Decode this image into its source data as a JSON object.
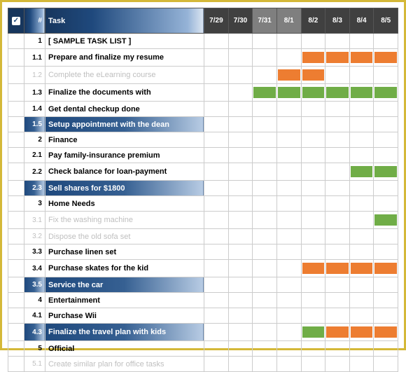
{
  "header": {
    "check": "✓",
    "num": "#",
    "task": "Task",
    "dates": [
      "7/29",
      "7/30",
      "7/31",
      "8/1",
      "8/2",
      "8/3",
      "8/4",
      "8/5"
    ],
    "highlight_cols": [
      2,
      3
    ]
  },
  "rows": [
    {
      "num": "1",
      "task": "[ SAMPLE TASK LIST ]",
      "style": "normal",
      "bars": []
    },
    {
      "num": "1.1",
      "task": "Prepare and finalize my resume",
      "style": "normal",
      "bars": [
        {
          "col": 4,
          "len": 4,
          "type": "orange"
        }
      ]
    },
    {
      "num": "1.2",
      "task": "Complete the eLearning course",
      "style": "faded",
      "bars": [
        {
          "col": 3,
          "len": 2,
          "type": "orange"
        }
      ]
    },
    {
      "num": "1.3",
      "task": "Finalize the documents with",
      "style": "normal",
      "bars": [
        {
          "col": 2,
          "len": 6,
          "type": "green"
        }
      ]
    },
    {
      "num": "1.4",
      "task": "Get dental checkup done",
      "style": "normal",
      "bars": []
    },
    {
      "num": "1.5",
      "task": "Setup appointment with the dean",
      "style": "highlight",
      "bars": []
    },
    {
      "num": "2",
      "task": "Finance",
      "style": "normal",
      "bars": []
    },
    {
      "num": "2.1",
      "task": "Pay family-insurance premium",
      "style": "normal",
      "bars": []
    },
    {
      "num": "2.2",
      "task": "Check balance for loan-payment",
      "style": "normal",
      "bars": [
        {
          "col": 6,
          "len": 2,
          "type": "green"
        }
      ]
    },
    {
      "num": "2.3",
      "task": "Sell shares for $1800",
      "style": "highlight",
      "bars": []
    },
    {
      "num": "3",
      "task": "Home Needs",
      "style": "normal",
      "bars": []
    },
    {
      "num": "3.1",
      "task": "Fix the washing machine",
      "style": "faded",
      "bars": [
        {
          "col": 7,
          "len": 1,
          "type": "green"
        }
      ]
    },
    {
      "num": "3.2",
      "task": "Dispose the old sofa set",
      "style": "faded",
      "bars": []
    },
    {
      "num": "3.3",
      "task": "Purchase linen set",
      "style": "normal",
      "bars": []
    },
    {
      "num": "3.4",
      "task": "Purchase skates for the kid",
      "style": "normal",
      "bars": [
        {
          "col": 4,
          "len": 4,
          "type": "orange"
        }
      ]
    },
    {
      "num": "3.5",
      "task": "Service the car",
      "style": "highlight",
      "bars": []
    },
    {
      "num": "4",
      "task": "Entertainment",
      "style": "normal",
      "bars": []
    },
    {
      "num": "4.1",
      "task": "Purchase Wii",
      "style": "normal",
      "bars": []
    },
    {
      "num": "4.3",
      "task": "Finalize the travel plan with kids",
      "style": "highlight",
      "bars": [
        {
          "col": 4,
          "len": 1,
          "type": "green"
        },
        {
          "col": 5,
          "len": 3,
          "type": "orange"
        }
      ]
    },
    {
      "num": "5",
      "task": "Official",
      "style": "normal",
      "bars": []
    },
    {
      "num": "5.1",
      "task": "Create similar plan for office tasks",
      "style": "faded",
      "bars": []
    }
  ]
}
